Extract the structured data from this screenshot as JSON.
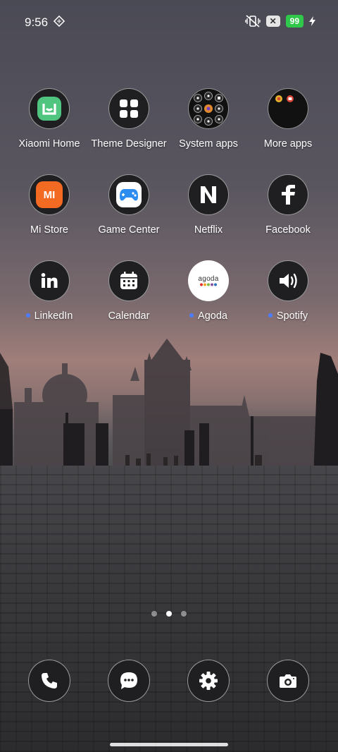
{
  "status_bar": {
    "time": "9:56",
    "battery": "99"
  },
  "apps": [
    {
      "label": "Xiaomi Home",
      "icon": "xiaomi-home-icon",
      "new": false
    },
    {
      "label": "Theme Designer",
      "icon": "grid-icon",
      "new": false
    },
    {
      "label": "System apps",
      "icon": "folder-icon",
      "new": false
    },
    {
      "label": "More apps",
      "icon": "folder-icon",
      "new": false
    },
    {
      "label": "Mi Store",
      "icon": "mi-store-icon",
      "new": false
    },
    {
      "label": "Game Center",
      "icon": "gamepad-icon",
      "new": false
    },
    {
      "label": "Netflix",
      "icon": "netflix-icon",
      "new": false
    },
    {
      "label": "Facebook",
      "icon": "facebook-icon",
      "new": false
    },
    {
      "label": "LinkedIn",
      "icon": "linkedin-icon",
      "new": true
    },
    {
      "label": "Calendar",
      "icon": "calendar-icon",
      "new": false
    },
    {
      "label": "Agoda",
      "icon": "agoda-icon",
      "new": true
    },
    {
      "label": "Spotify",
      "icon": "speaker-icon",
      "new": true
    }
  ],
  "agoda_logo_text": "agoda",
  "mi_logo_text": "MI",
  "page_indicator": {
    "count": 3,
    "active": 2
  },
  "dock": [
    {
      "name": "phone",
      "icon": "phone-icon"
    },
    {
      "name": "messages",
      "icon": "chat-icon"
    },
    {
      "name": "settings",
      "icon": "gear-icon"
    },
    {
      "name": "camera",
      "icon": "camera-icon"
    }
  ]
}
